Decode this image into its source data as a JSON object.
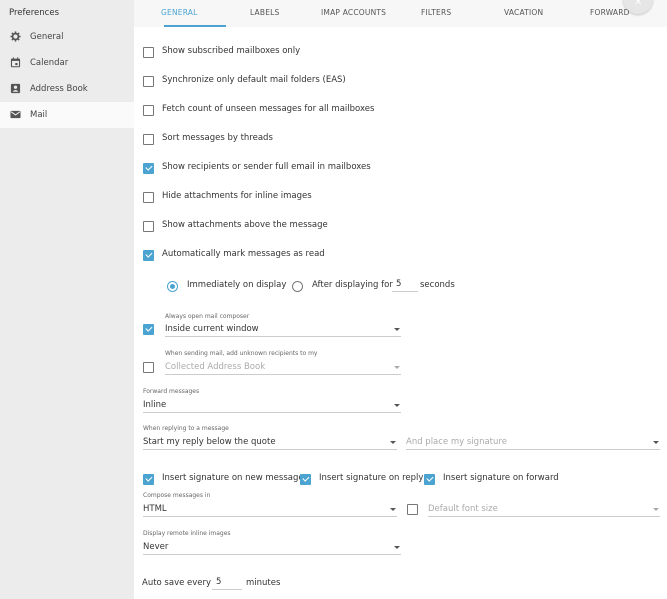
{
  "sidebar": {
    "title": "Preferences",
    "items": [
      {
        "label": "General",
        "icon": "gear-icon"
      },
      {
        "label": "Calendar",
        "icon": "calendar-icon"
      },
      {
        "label": "Address Book",
        "icon": "contact-card-icon"
      },
      {
        "label": "Mail",
        "icon": "envelope-icon"
      }
    ],
    "active": "Mail"
  },
  "tabs": [
    "GENERAL",
    "LABELS",
    "IMAP ACCOUNTS",
    "FILTERS",
    "VACATION",
    "FORWARD"
  ],
  "active_tab": "GENERAL",
  "accent_color": "#4aa3d1",
  "options": [
    {
      "label": "Show subscribed mailboxes only",
      "checked": false
    },
    {
      "label": "Synchronize only default mail folders (EAS)",
      "checked": false
    },
    {
      "label": "Fetch count of unseen messages for all mailboxes",
      "checked": false
    },
    {
      "label": "Sort messages by threads",
      "checked": false
    },
    {
      "label": "Show recipients or sender full email in mailboxes",
      "checked": true
    },
    {
      "label": "Hide attachments for inline images",
      "checked": false
    },
    {
      "label": "Show attachments above the message",
      "checked": false
    },
    {
      "label": "Automatically mark messages as read",
      "checked": true
    }
  ],
  "mark_read": {
    "immediately_label": "Immediately on display",
    "after_label": "After displaying for",
    "seconds_value": "5",
    "seconds_label": "seconds",
    "selected": "immediately"
  },
  "composer": {
    "caption": "Always open mail composer",
    "value": "Inside current window",
    "checked": true
  },
  "unknown_recipients": {
    "caption": "When sending mail, add unknown recipients to my",
    "value": "Collected Address Book",
    "checked": false
  },
  "forward": {
    "caption": "Forward messages",
    "value": "Inline"
  },
  "reply": {
    "caption": "When replying to a message",
    "value": "Start my reply below the quote",
    "signature_placeholder": "And place my signature"
  },
  "signature_opts": [
    {
      "label": "Insert signature on new message",
      "checked": true
    },
    {
      "label": "Insert signature on reply",
      "checked": true
    },
    {
      "label": "Insert signature on forward",
      "checked": true
    }
  ],
  "compose": {
    "caption": "Compose messages in",
    "value": "HTML",
    "font_size_placeholder": "Default font size",
    "font_size_checked": false
  },
  "remote_images": {
    "caption": "Display remote inline images",
    "value": "Never"
  },
  "autosave": {
    "label": "Auto save every",
    "value": "5",
    "unit": "minutes"
  }
}
